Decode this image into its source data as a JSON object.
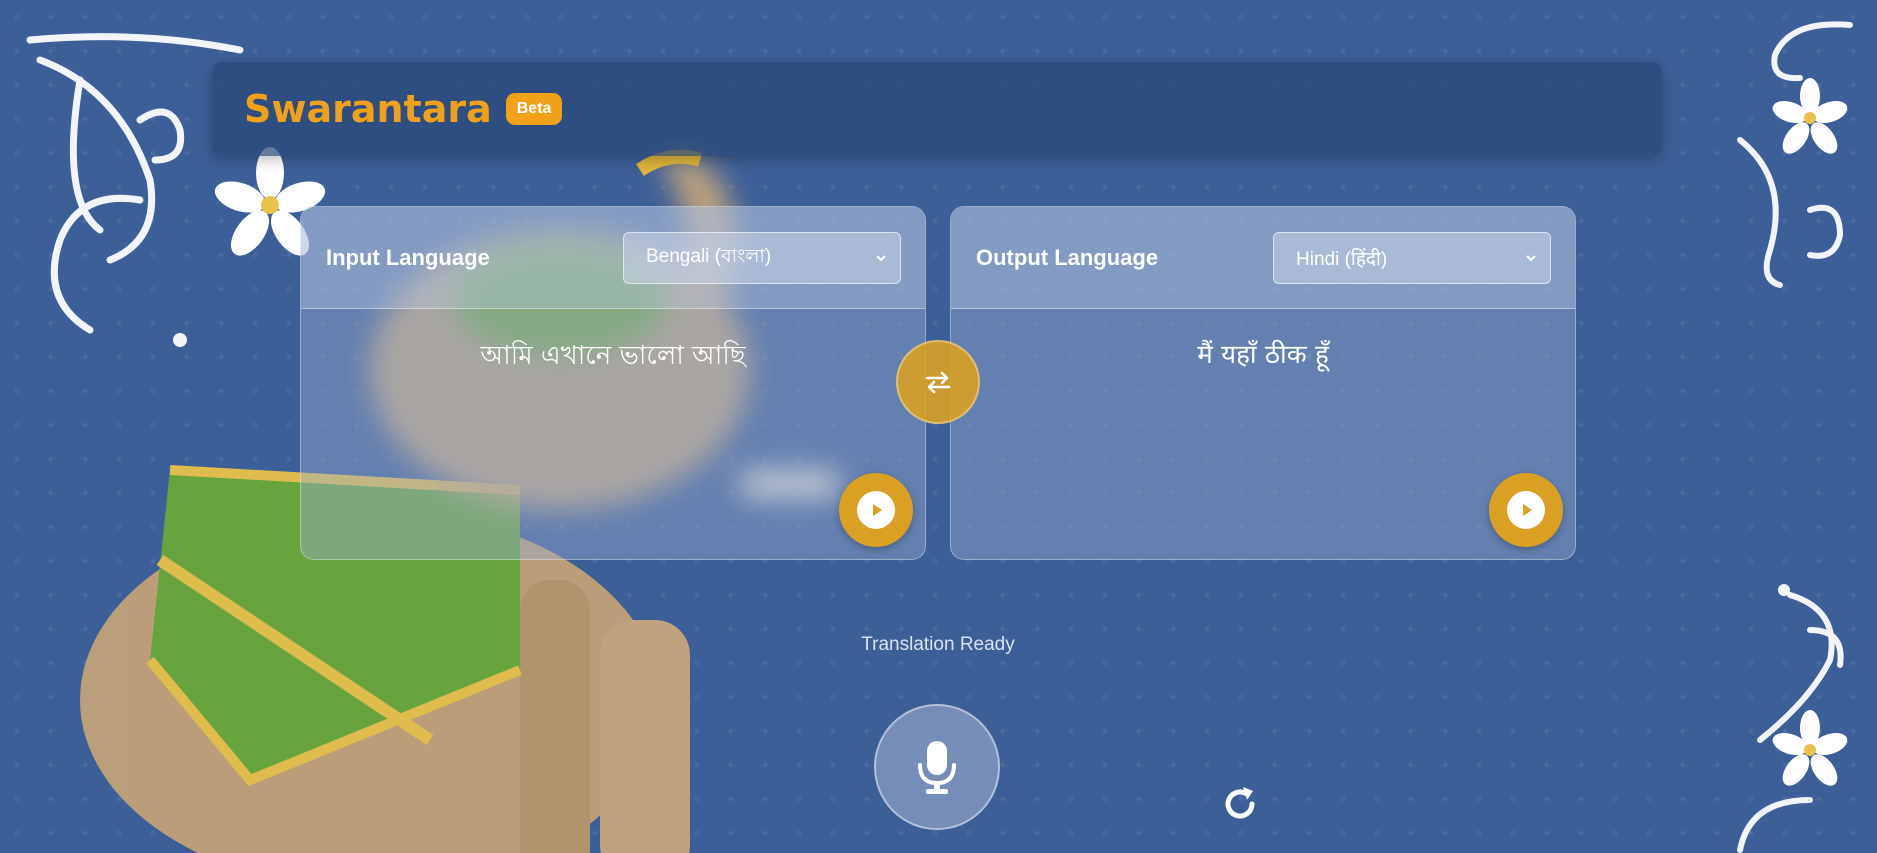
{
  "header": {
    "title": "Swarantara",
    "badge": "Beta"
  },
  "input_panel": {
    "label": "Input Language",
    "selected_language": "Bengali (বাংলা)",
    "text": "আমি এখানে ভালো আছি",
    "play_icon": "play-icon"
  },
  "output_panel": {
    "label": "Output Language",
    "selected_language": "Hindi (हिंदी)",
    "text": "मैं यहाँ ठीक हूँ",
    "play_icon": "play-icon"
  },
  "swap": {
    "icon": "swap-arrows-icon"
  },
  "status": {
    "text": "Translation Ready"
  },
  "mic": {
    "icon": "microphone-icon"
  },
  "refresh": {
    "icon": "refresh-icon"
  },
  "colors": {
    "accent": "#f0a11a",
    "button_gold": "#d9a024",
    "background": "#3d5f98"
  }
}
